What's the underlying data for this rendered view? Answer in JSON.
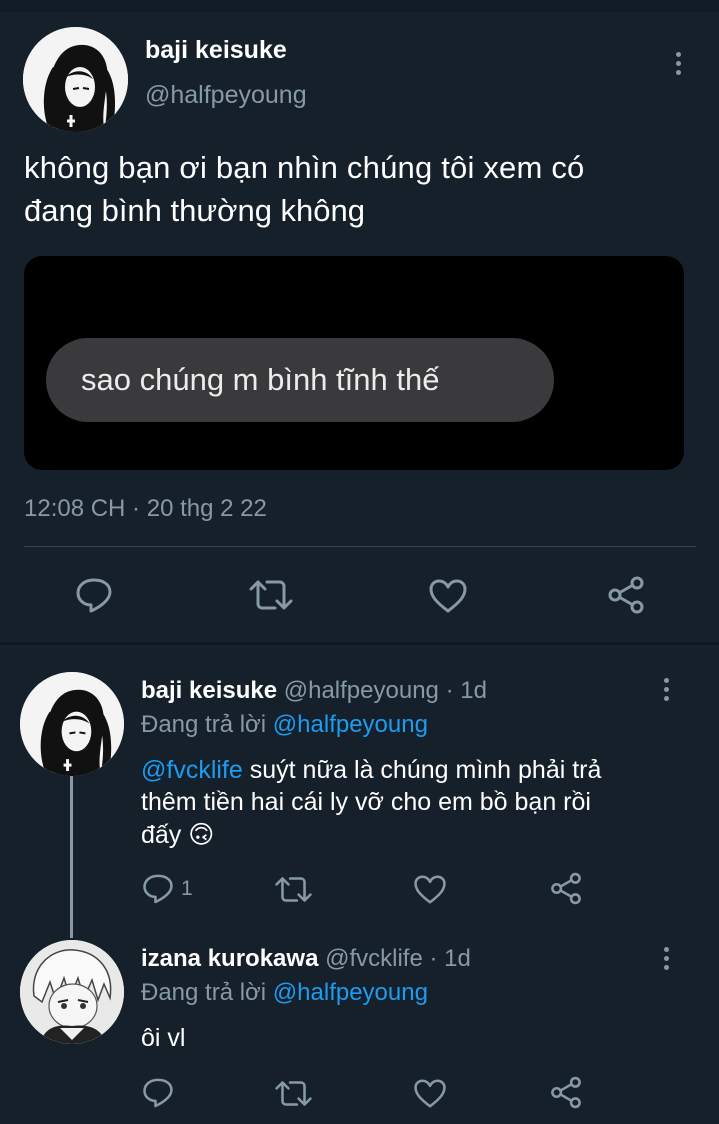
{
  "main_tweet": {
    "display_name": "baji keisuke",
    "handle": "@halfpeyoung",
    "text_line1": "không bạn ơi bạn nhìn chúng tôi xem có",
    "text_line2": "đang bình thường không",
    "image_bubble_text": "sao chúng m bình tĩnh thế",
    "timestamp": "12:08 CH · 20 thg 2 22"
  },
  "replies": [
    {
      "display_name": "baji keisuke",
      "handle": "@halfpeyoung",
      "age": "· 1d",
      "replying_prefix": "Đang trả lời",
      "replying_to": "@halfpeyoung",
      "mention": "@fvcklife",
      "text_line1_rest": " suýt nữa là chúng mình phải trả",
      "text_line2": "thêm tiền hai cái ly vỡ cho em bồ bạn rồi",
      "text_line3": "đấy",
      "emoji": "🙃",
      "reply_count": "1"
    },
    {
      "display_name": "izana kurokawa",
      "handle": "@fvcklife",
      "age": "· 1d",
      "replying_prefix": "Đang trả lời",
      "replying_to": "@halfpeyoung",
      "text": "ôi vl"
    }
  ],
  "colors": {
    "background": "#15202b",
    "muted": "#8899a6",
    "link": "#1d9bf0",
    "divider": "#38444d"
  },
  "icons": [
    "reply-icon",
    "retweet-icon",
    "like-icon",
    "share-icon",
    "more-options-icon"
  ]
}
